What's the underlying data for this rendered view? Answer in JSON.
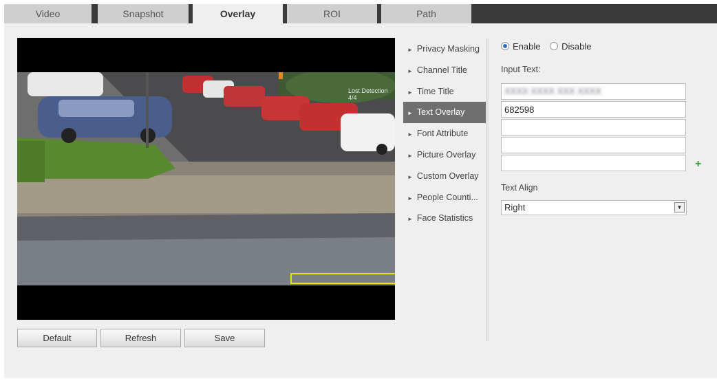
{
  "tabs": [
    {
      "label": "Video",
      "active": false
    },
    {
      "label": "Snapshot",
      "active": false
    },
    {
      "label": "Overlay",
      "active": true
    },
    {
      "label": "ROI",
      "active": false
    },
    {
      "label": "Path",
      "active": false
    }
  ],
  "preview": {
    "channel_title": "Lost Detection 4/4"
  },
  "buttons": {
    "default_label": "Default",
    "refresh_label": "Refresh",
    "save_label": "Save"
  },
  "menu": {
    "items": [
      {
        "label": "Privacy Masking",
        "active": false
      },
      {
        "label": "Channel Title",
        "active": false
      },
      {
        "label": "Time Title",
        "active": false
      },
      {
        "label": "Text Overlay",
        "active": true
      },
      {
        "label": "Font Attribute",
        "active": false
      },
      {
        "label": "Picture Overlay",
        "active": false
      },
      {
        "label": "Custom Overlay",
        "active": false
      },
      {
        "label": "People Counti...",
        "active": false
      },
      {
        "label": "Face Statistics",
        "active": false
      }
    ]
  },
  "form": {
    "enable_label": "Enable",
    "disable_label": "Disable",
    "enabled": true,
    "input_text_label": "Input Text:",
    "inputs": [
      "",
      "682598",
      "",
      "",
      ""
    ],
    "text_align_label": "Text Align",
    "text_align_value": "Right"
  },
  "colors": {
    "tab_bar": "#3a3a3a",
    "active_menu": "#6f6f6f",
    "overlay_box": "#e5e500",
    "add_icon": "#3aa33a"
  }
}
